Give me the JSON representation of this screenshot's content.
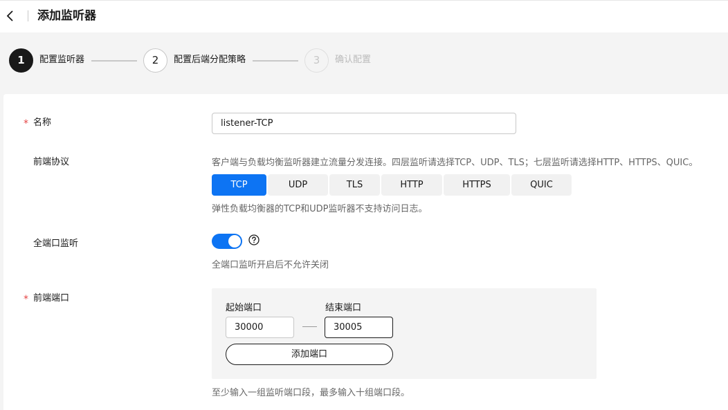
{
  "header": {
    "title": "添加监听器"
  },
  "steps": [
    {
      "number": "1",
      "label": "配置监听器",
      "state": "active"
    },
    {
      "number": "2",
      "label": "配置后端分配策略",
      "state": "normal"
    },
    {
      "number": "3",
      "label": "确认配置",
      "state": "disabled"
    }
  ],
  "form": {
    "required_mark": "*",
    "name": {
      "label": "名称",
      "value": "listener-TCP"
    },
    "protocol": {
      "label": "前端协议",
      "description": "客户端与负载均衡监听器建立流量分发连接。四层监听请选择TCP、UDP、TLS；七层监听请选择HTTP、HTTPS、QUIC。",
      "options": [
        "TCP",
        "UDP",
        "TLS",
        "HTTP",
        "HTTPS",
        "QUIC"
      ],
      "selected": "TCP",
      "note": "弹性负载均衡器的TCP和UDP监听器不支持访问日志。"
    },
    "all_port": {
      "label": "全端口监听",
      "enabled": true,
      "help_icon": "question-circle-icon",
      "note": "全端口监听开启后不允许关闭"
    },
    "port": {
      "label": "前端端口",
      "start_label": "起始端口",
      "end_label": "结束端口",
      "start_value": "30000",
      "end_value": "30005",
      "add_button": "添加端口",
      "note": "至少输入一组监听端口段，最多输入十组端口段。"
    }
  },
  "colors": {
    "primary": "#0d74f3",
    "required": "#e54545"
  }
}
